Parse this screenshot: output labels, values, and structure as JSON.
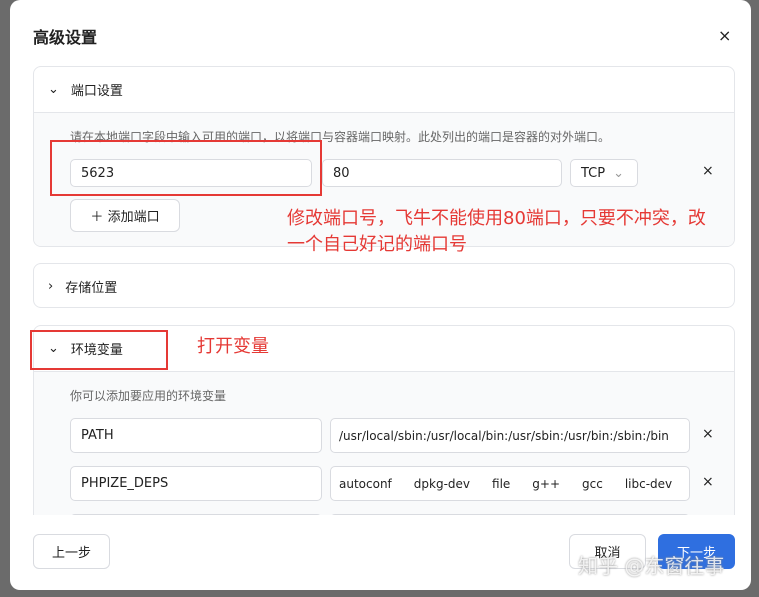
{
  "dialog": {
    "title": "高级设置",
    "close": "×"
  },
  "ports": {
    "title": "端口设置",
    "hint": "请在本地端口字段中输入可用的端口，以将端口与容器端口映射。此处列出的端口是容器的对外端口。",
    "local": "5623",
    "container": "80",
    "protocol": "TCP",
    "add": "添加端口"
  },
  "storage": {
    "title": "存储位置"
  },
  "env": {
    "title": "环境变量",
    "hint": "你可以添加要应用的环境变量",
    "rows": [
      {
        "key": "PATH",
        "value": "/usr/local/sbin:/usr/local/bin:/usr/sbin:/usr/bin:/sbin:/bin"
      },
      {
        "key": "PHPIZE_DEPS",
        "tags": [
          "autoconf",
          "dpkg-dev",
          "file",
          "g++",
          "gcc",
          "libc-dev"
        ]
      }
    ]
  },
  "footer": {
    "prev": "上一步",
    "cancel": "取消",
    "next": "下一步"
  },
  "annotations": {
    "port_note": "修改端口号，飞牛不能使用80端口，只要不冲突，改一个自己好记的端口号",
    "env_note": "打开变量"
  },
  "watermark": "知乎 @东窗往事",
  "colors": {
    "accent": "#2f6fe0",
    "annotation": "#e53935"
  }
}
